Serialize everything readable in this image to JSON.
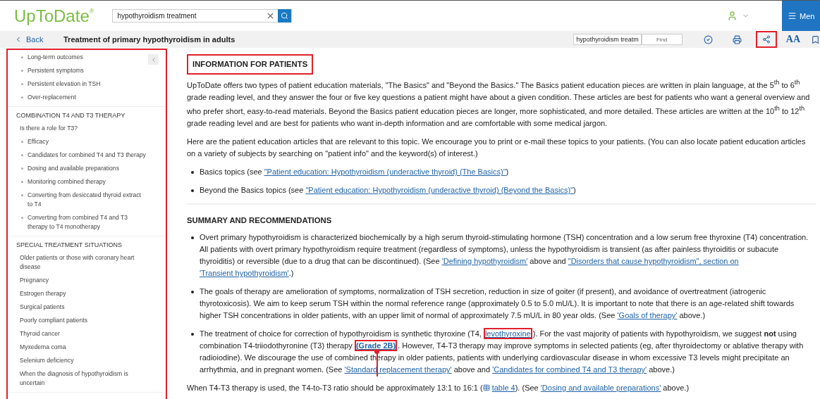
{
  "header": {
    "logo": "UpToDate",
    "logo_mark": "®",
    "search": {
      "value": "hypothyroidism treatment"
    },
    "menu_label": "Men"
  },
  "toolbar": {
    "back": "Back",
    "title": "Treatment of primary hypothyroidism in adults",
    "find_field": {
      "value": "hypothyroidism treatm"
    },
    "find_button": "Find",
    "font_size_label": "AA",
    "share_highlighted": true
  },
  "sidebar": {
    "highlighted": true,
    "sections": [
      {
        "items": [
          {
            "label": "Long-term outcomes",
            "kind": "bullet"
          },
          {
            "label": "Persistent symptoms",
            "kind": "bullet"
          },
          {
            "label": "Persistent elevation in TSH",
            "kind": "bullet"
          },
          {
            "label": "Over-replacement",
            "kind": "bullet"
          }
        ]
      },
      {
        "heading": "COMBINATION T4 AND T3 THERAPY",
        "items": [
          {
            "label": "Is there a role for T3?",
            "kind": "sub"
          },
          {
            "label": "Efficacy",
            "kind": "bullet"
          },
          {
            "label": "Candidates for combined T4 and T3 therapy",
            "kind": "bullet"
          },
          {
            "label": "Dosing and available preparations",
            "kind": "bullet"
          },
          {
            "label": "Monitoring combined therapy",
            "kind": "bullet"
          },
          {
            "label": "Converting from desiccated thyroid extract to T4",
            "kind": "bullet"
          },
          {
            "label": "Converting from combined T4 and T3 therapy to T4 monotherapy",
            "kind": "bullet"
          }
        ]
      },
      {
        "heading": "SPECIAL TREATMENT SITUATIONS",
        "items": [
          {
            "label": "Older patients or those with coronary heart disease",
            "kind": "sub"
          },
          {
            "label": "Pregnancy",
            "kind": "sub"
          },
          {
            "label": "Estrogen therapy",
            "kind": "sub"
          },
          {
            "label": "Surgical patients",
            "kind": "sub"
          },
          {
            "label": "Poorly compliant patients",
            "kind": "sub"
          },
          {
            "label": "Thyroid cancer",
            "kind": "sub"
          },
          {
            "label": "Myxedema coma",
            "kind": "sub"
          },
          {
            "label": "Selenium deficiency",
            "kind": "sub"
          },
          {
            "label": "When the diagnosis of hypothyroidism is uncertain",
            "kind": "sub"
          }
        ]
      }
    ]
  },
  "sections": [
    {
      "heading": "INFORMATION FOR PATIENTS",
      "highlighted": true,
      "blocks": [
        {
          "kind": "paragraph",
          "parts": [
            {
              "kind": "text",
              "text": "UpToDate offers two types of patient education materials, \"The Basics\" and \"Beyond the Basics.\" The Basics patient education pieces are written in plain language, at the 5$^{th}$ to 6$^{th}$ grade reading level, and they answer the four or five key questions a patient might have about a given condition. These articles are best for patients who want a general overview and who prefer short, easy-to-read materials. Beyond the Basics patient education pieces are longer, more sophisticated, and more detailed. These articles are written at the 10$^{th}$ to 12$^{th}$ grade reading level and are best for patients who want in-depth information and are comfortable with some medical jargon."
            }
          ]
        },
        {
          "kind": "paragraph",
          "parts": [
            {
              "kind": "text",
              "text": "Here are the patient education articles that are relevant to this topic. We encourage you to print or e-mail these topics to your patients. (You can also locate patient education articles on a variety of subjects by searching on \"patient info\" and the keyword(s) of interest.)"
            }
          ]
        },
        {
          "kind": "bullet",
          "parts": [
            {
              "kind": "text",
              "text": "Basics topics (see "
            },
            {
              "kind": "link",
              "text": "\"Patient education: Hypothyroidism (underactive thyroid) (The Basics)\""
            },
            {
              "kind": "text",
              "text": ")"
            }
          ]
        },
        {
          "kind": "bullet",
          "parts": [
            {
              "kind": "text",
              "text": "Beyond the Basics topics (see "
            },
            {
              "kind": "link",
              "text": "\"Patient education: Hypothyroidism (underactive thyroid) (Beyond the Basics)\""
            },
            {
              "kind": "text",
              "text": ")"
            }
          ]
        }
      ]
    },
    {
      "heading": "SUMMARY AND RECOMMENDATIONS",
      "highlighted": false,
      "blocks": [
        {
          "kind": "bullet",
          "parts": [
            {
              "kind": "text",
              "text": "Overt primary hypothyroidism is characterized biochemically by a high serum thyroid-stimulating hormone (TSH) concentration and a low serum free thyroxine (T4) concentration. All patients with overt primary hypothyroidism require treatment (regardless of symptoms), unless the hypothyroidism is transient (as after painless thyroiditis or subacute thyroiditis) or reversible (due to a drug that can be discontinued). (See "
            },
            {
              "kind": "link",
              "text": "'Defining hypothyroidism'"
            },
            {
              "kind": "text",
              "text": " above and "
            },
            {
              "kind": "link",
              "text": "\"Disorders that cause hypothyroidism\", section on"
            },
            {
              "kind": "link",
              "text": "'Transient hypothyroidism'"
            },
            {
              "kind": "text",
              "text": ".)"
            }
          ]
        },
        {
          "kind": "bullet",
          "parts": [
            {
              "kind": "text",
              "text": "The goals of therapy are amelioration of symptoms, normalization of TSH secretion, reduction in size of goiter (if present), and avoidance of overtreatment (iatrogenic thyrotoxicosis). We aim to keep serum TSH within the normal reference range (approximately 0.5 to 5.0 mU/L). It is important to note that there is an age-related shift towards higher TSH concentrations in older patients, with an upper limit of normal of approximately 7.5 mU/L in 80 year olds. (See "
            },
            {
              "kind": "link",
              "text": "'Goals of therapy'"
            },
            {
              "kind": "text",
              "text": " above.)"
            }
          ]
        },
        {
          "kind": "bullet",
          "parts": [
            {
              "kind": "text",
              "text": "The treatment of choice for correction of hypothyroidism is synthetic thyroxine (T4, "
            },
            {
              "kind": "link",
              "text": "levothyroxine",
              "highlighted": true
            },
            {
              "kind": "text",
              "text": "). For the vast majority of patients with hypothyroidism, we suggest **not** using combination T4-triiodothyronine (T3) therapy "
            },
            {
              "kind": "grade",
              "text": "(Grade 2B)",
              "highlighted": true
            },
            {
              "kind": "text",
              "text": ". However, T4-T3 therapy may improve symptoms in selected patients (eg, after thyroidectomy or ablative therapy with radioiodine). We discourage the use of combined therapy in older patients, patients with underlying cardiovascular disease in whom excessive T3 levels might precipitate an arrhythmia, and in pregnant women. (See "
            },
            {
              "kind": "link",
              "text": "'Standard replacement therapy'"
            },
            {
              "kind": "text",
              "text": " above and "
            },
            {
              "kind": "link",
              "text": "'Candidates for combined T4 and T3 therapy'"
            },
            {
              "kind": "text",
              "text": " above.)"
            }
          ]
        },
        {
          "kind": "paragraph",
          "parts": [
            {
              "kind": "text",
              "text": "When T4-T3 therapy is used, the T4-to-T3 ratio should be approximately 13:1 to 16:1 ("
            },
            {
              "kind": "table_link",
              "text": "table 4"
            },
            {
              "kind": "text",
              "text": "). (See "
            },
            {
              "kind": "link",
              "text": "'Dosing and available preparations'"
            },
            {
              "kind": "text",
              "text": " above.)"
            }
          ]
        }
      ]
    }
  ]
}
